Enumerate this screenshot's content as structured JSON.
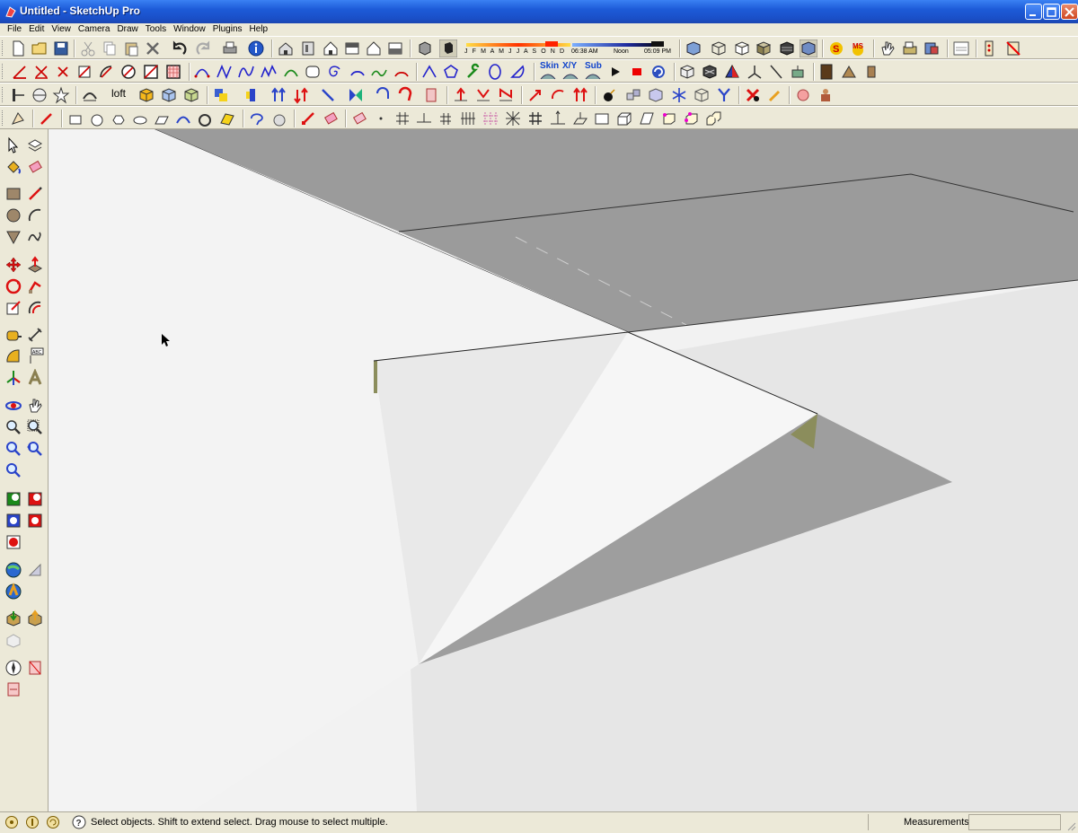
{
  "window": {
    "title": "Untitled - SketchUp Pro"
  },
  "menu": [
    "File",
    "Edit",
    "View",
    "Camera",
    "Draw",
    "Tools",
    "Window",
    "Plugins",
    "Help"
  ],
  "shadow_toolbar": {
    "months": "J F M A M J J A S O N D",
    "time_start": "06:38 AM",
    "time_noon": "Noon",
    "time_end": "05:09 PM"
  },
  "plugin_toolbar": {
    "skin": "Skin",
    "xy": "X/Y",
    "sub": "Sub"
  },
  "loft_label": "loft",
  "status": {
    "hint": "Select objects. Shift to extend select. Drag mouse to select multiple.",
    "measurements_label": "Measurements",
    "measurements_value": ""
  },
  "colors": {
    "title_bar": "#1d5bd8",
    "chrome": "#ece9d8",
    "viewport_bg": "#f2f2f2",
    "shadow_gray": "#9e9e9e",
    "ground_gray": "#e0e0e0"
  }
}
